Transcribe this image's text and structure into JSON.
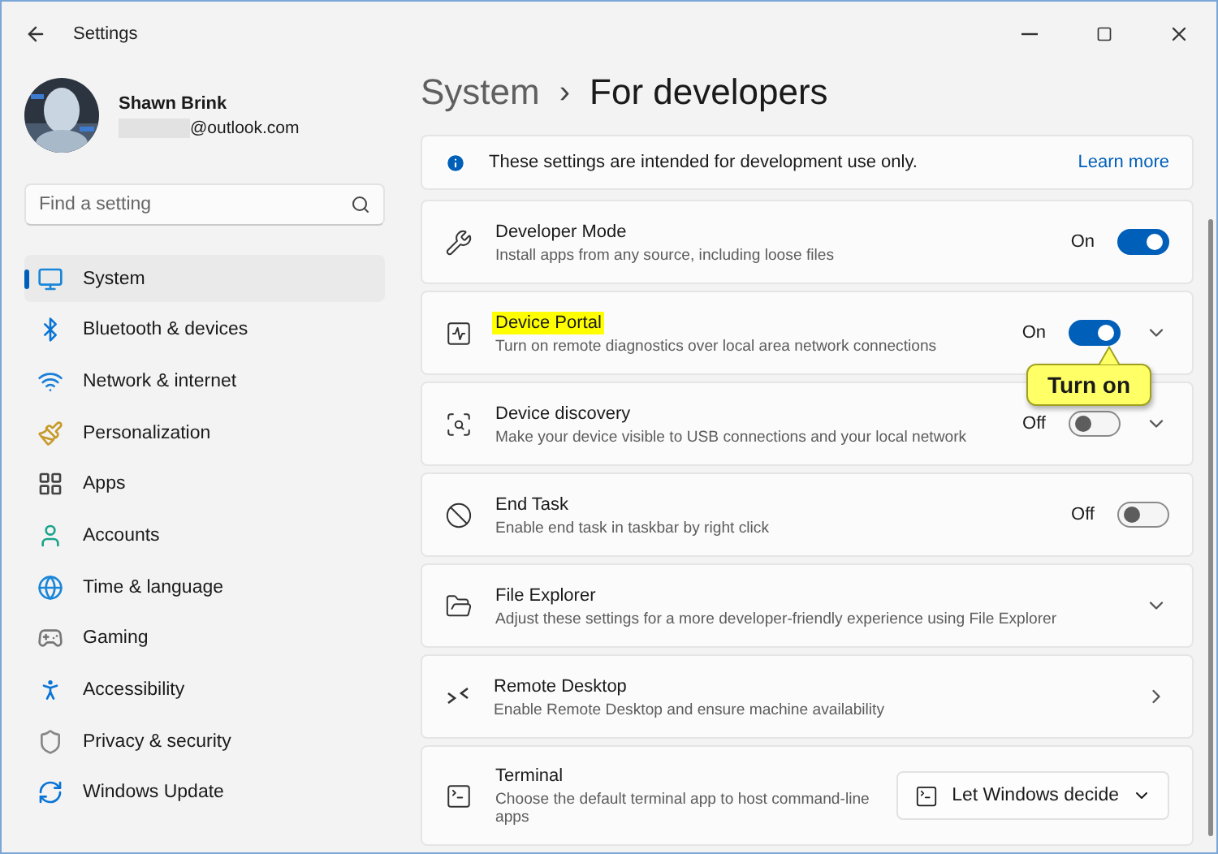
{
  "window": {
    "title": "Settings"
  },
  "account": {
    "name": "Shawn Brink",
    "email": "@outlook.com"
  },
  "search": {
    "placeholder": "Find a setting"
  },
  "sidebar": {
    "items": [
      {
        "label": "System",
        "selected": true
      },
      {
        "label": "Bluetooth & devices",
        "selected": false
      },
      {
        "label": "Network & internet",
        "selected": false
      },
      {
        "label": "Personalization",
        "selected": false
      },
      {
        "label": "Apps",
        "selected": false
      },
      {
        "label": "Accounts",
        "selected": false
      },
      {
        "label": "Time & language",
        "selected": false
      },
      {
        "label": "Gaming",
        "selected": false
      },
      {
        "label": "Accessibility",
        "selected": false
      },
      {
        "label": "Privacy & security",
        "selected": false
      },
      {
        "label": "Windows Update",
        "selected": false
      }
    ]
  },
  "breadcrumb": {
    "parent": "System",
    "separator": "›",
    "current": "For developers"
  },
  "info_bar": {
    "text": "These settings are intended for development use only.",
    "link": "Learn more"
  },
  "settings": [
    {
      "kind": "toggle",
      "title": "Developer Mode",
      "description": "Install apps from any source, including loose files",
      "state_label": "On",
      "on": true,
      "expandable": false,
      "highlighted": false
    },
    {
      "kind": "toggle",
      "title": "Device Portal",
      "description": "Turn on remote diagnostics over local area network connections",
      "state_label": "On",
      "on": true,
      "expandable": true,
      "highlighted": true,
      "callout": "Turn on"
    },
    {
      "kind": "toggle",
      "title": "Device discovery",
      "description": "Make your device visible to USB connections and your local network",
      "state_label": "Off",
      "on": false,
      "expandable": true,
      "highlighted": false
    },
    {
      "kind": "toggle",
      "title": "End Task",
      "description": "Enable end task in taskbar by right click",
      "state_label": "Off",
      "on": false,
      "expandable": false,
      "highlighted": false
    },
    {
      "kind": "expander",
      "title": "File Explorer",
      "description": "Adjust these settings for a more developer-friendly experience using File Explorer",
      "highlighted": false
    },
    {
      "kind": "link",
      "title": "Remote Desktop",
      "description": "Enable Remote Desktop and ensure machine availability",
      "highlighted": false
    },
    {
      "kind": "select",
      "title": "Terminal",
      "description": "Choose the default terminal app to host command-line apps",
      "value": "Let Windows decide",
      "highlighted": false
    }
  ]
}
